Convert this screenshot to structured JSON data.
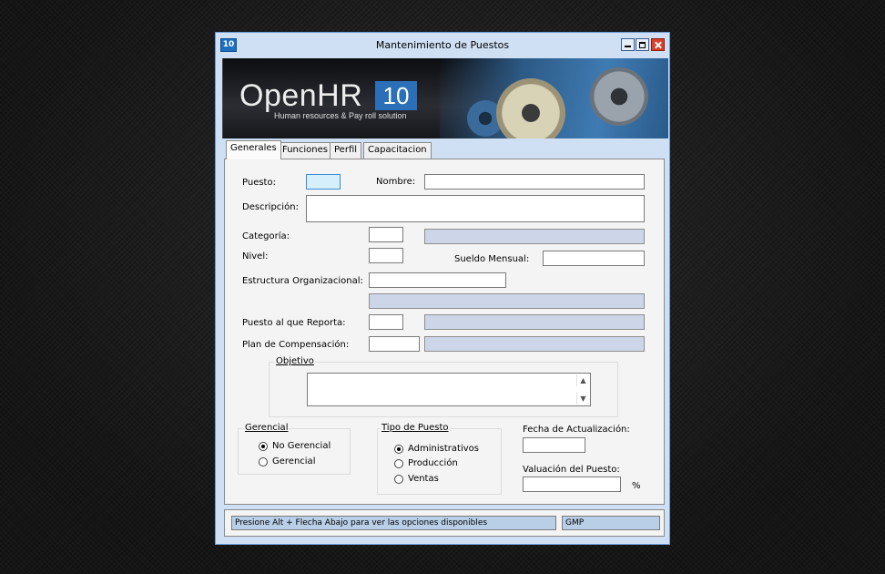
{
  "window": {
    "icon": "10",
    "title": "Mantenimiento de Puestos"
  },
  "banner": {
    "brand": "OpenHR",
    "version": "10",
    "tagline": "Human resources & Pay roll solution"
  },
  "tabs": [
    {
      "label": "Generales",
      "active": true
    },
    {
      "label": "Funciones"
    },
    {
      "label": "Perfil"
    },
    {
      "label": "Capacitacion"
    }
  ],
  "form": {
    "puesto_label": "Puesto:",
    "nombre_label": "Nombre:",
    "descripcion_label": "Descripción:",
    "categoria_label": "Categoría:",
    "nivel_label": "Nivel:",
    "sueldo_label": "Sueldo Mensual:",
    "estructura_label": "Estructura Organizacional:",
    "reporta_label": "Puesto al que Reporta:",
    "plan_label": "Plan de Compensación:"
  },
  "objetivo": {
    "title": "Objetivo"
  },
  "gerencial": {
    "title": "Gerencial",
    "options": [
      {
        "label": "No Gerencial",
        "selected": true
      },
      {
        "label": "Gerencial",
        "selected": false
      }
    ]
  },
  "tipo_puesto": {
    "title": "Tipo de Puesto",
    "options": [
      {
        "label": "Administrativos",
        "selected": true
      },
      {
        "label": "Producción",
        "selected": false
      },
      {
        "label": "Ventas",
        "selected": false
      }
    ]
  },
  "fecha_label": "Fecha de Actualización:",
  "valuacion_label": "Valuación del Puesto:",
  "percent_symbol": "%",
  "status": {
    "message": "Presione Alt + Flecha Abajo para ver las opciones disponibles",
    "user": "GMP"
  },
  "colors": {
    "readonly_field": "#cdd6e8",
    "focused_field": "#d6f0fb",
    "window_frame": "#cfe0f4",
    "close_button": "#d9412b"
  }
}
